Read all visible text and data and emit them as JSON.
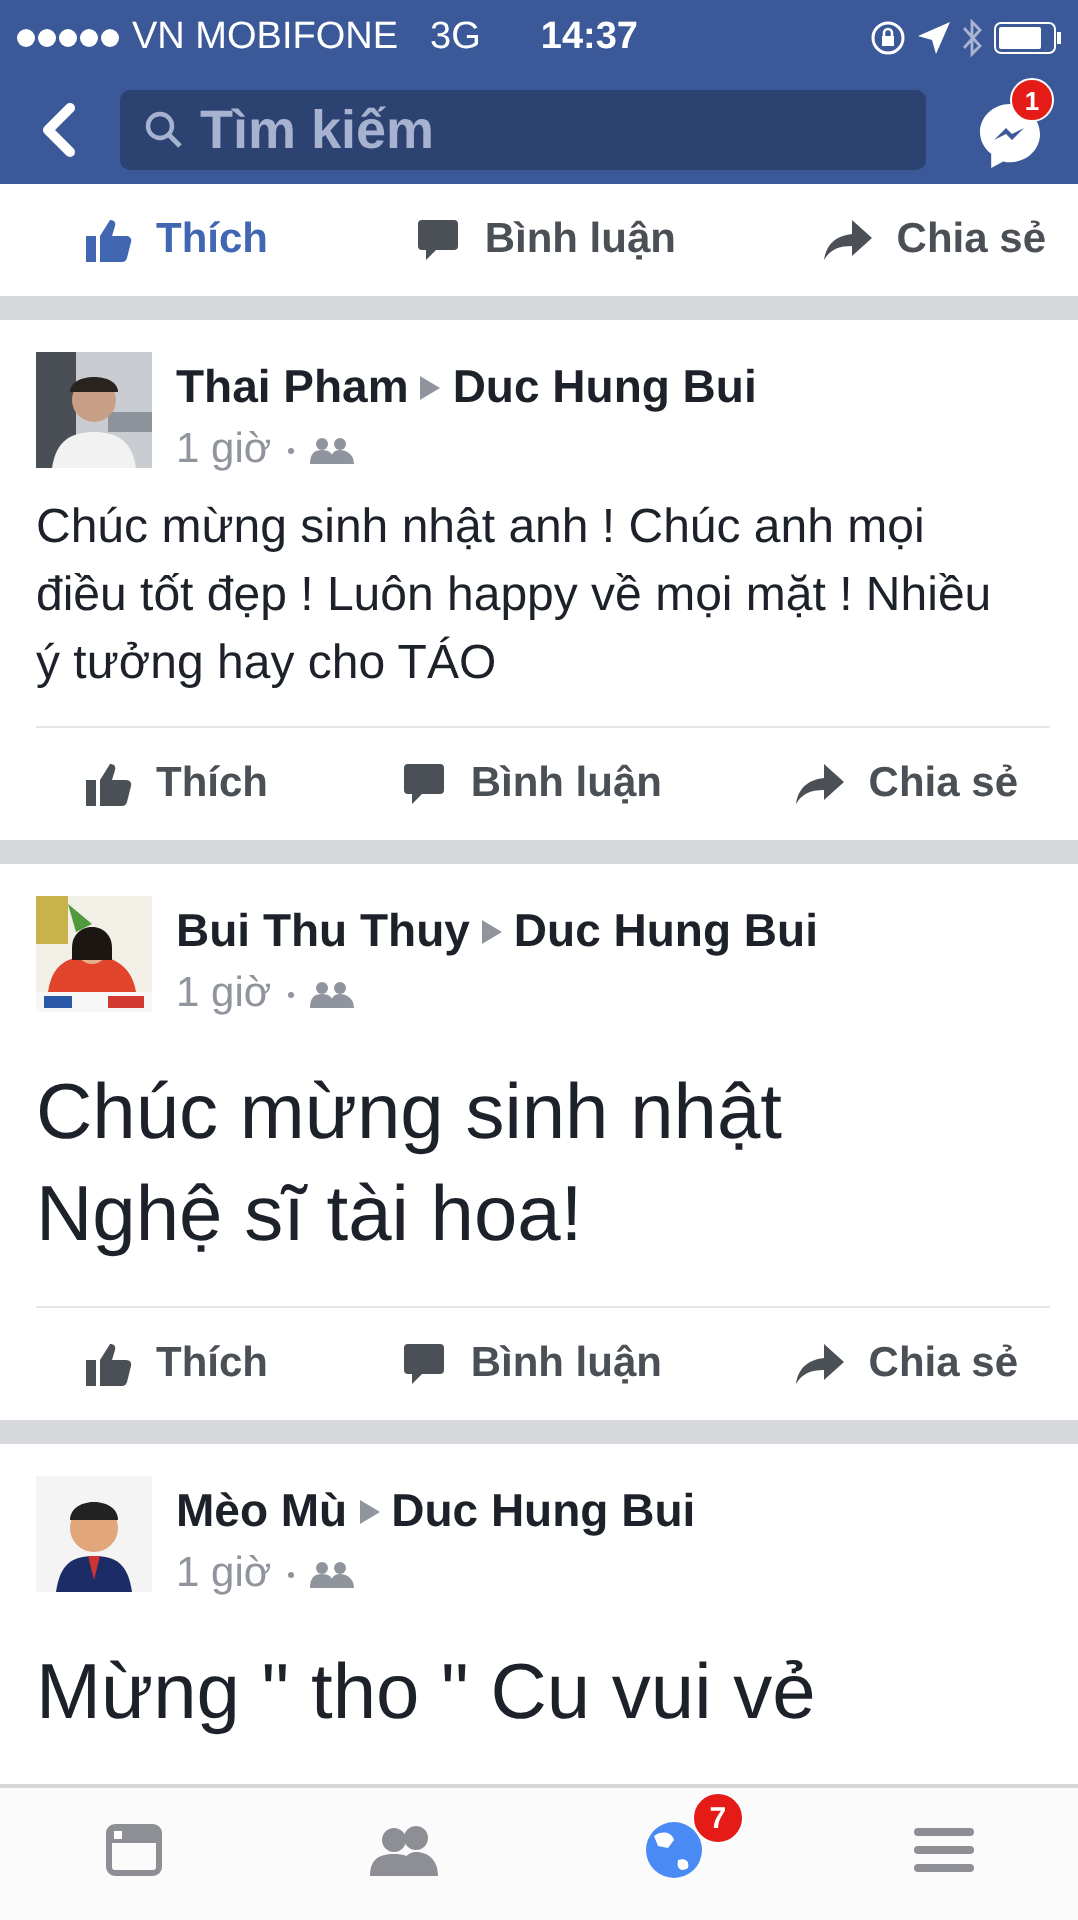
{
  "status_bar": {
    "carrier": "VN MOBIFONE",
    "network": "3G",
    "time": "14:37"
  },
  "nav": {
    "search": {
      "placeholder": "Tìm kiếm"
    },
    "messenger_badge": "1"
  },
  "previous_post_actions": [
    {
      "kind": "like",
      "label": "Thích",
      "selected": true
    },
    {
      "kind": "comment",
      "label": "Bình luận",
      "selected": false
    },
    {
      "kind": "share",
      "label": "Chia sẻ",
      "selected": false
    }
  ],
  "posts": [
    {
      "author": "Thai Pham",
      "target": "Duc Hung Bui",
      "time": "1 giờ",
      "kind": "normal",
      "text": "Chúc mừng sinh nhật anh ! Chúc anh mọi điều tốt đẹp ! Luôn happy về mọi mặt ! Nhiều ý tưởng hay cho TÁO",
      "actions": [
        {
          "kind": "like",
          "label": "Thích",
          "selected": false
        },
        {
          "kind": "comment",
          "label": "Bình luận",
          "selected": false
        },
        {
          "kind": "share",
          "label": "Chia sẻ",
          "selected": false
        }
      ]
    },
    {
      "author": "Bui Thu Thuy",
      "target": "Duc Hung Bui",
      "time": "1 giờ",
      "kind": "large",
      "text": "Chúc mừng sinh nhật Nghệ sĩ tài hoa!",
      "actions": [
        {
          "kind": "like",
          "label": "Thích",
          "selected": false
        },
        {
          "kind": "comment",
          "label": "Bình luận",
          "selected": false
        },
        {
          "kind": "share",
          "label": "Chia sẻ",
          "selected": false
        }
      ]
    },
    {
      "author": "Mèo Mù",
      "target": "Duc Hung Bui",
      "time": "1 giờ",
      "kind": "large",
      "text": "Mừng \" tho \" Cu vui vẻ"
    }
  ],
  "tab_bar": [
    {
      "kind": "feed",
      "selected": false
    },
    {
      "kind": "friends",
      "selected": false
    },
    {
      "kind": "notifications",
      "selected": true,
      "badge": "7"
    },
    {
      "kind": "menu",
      "selected": false
    }
  ]
}
